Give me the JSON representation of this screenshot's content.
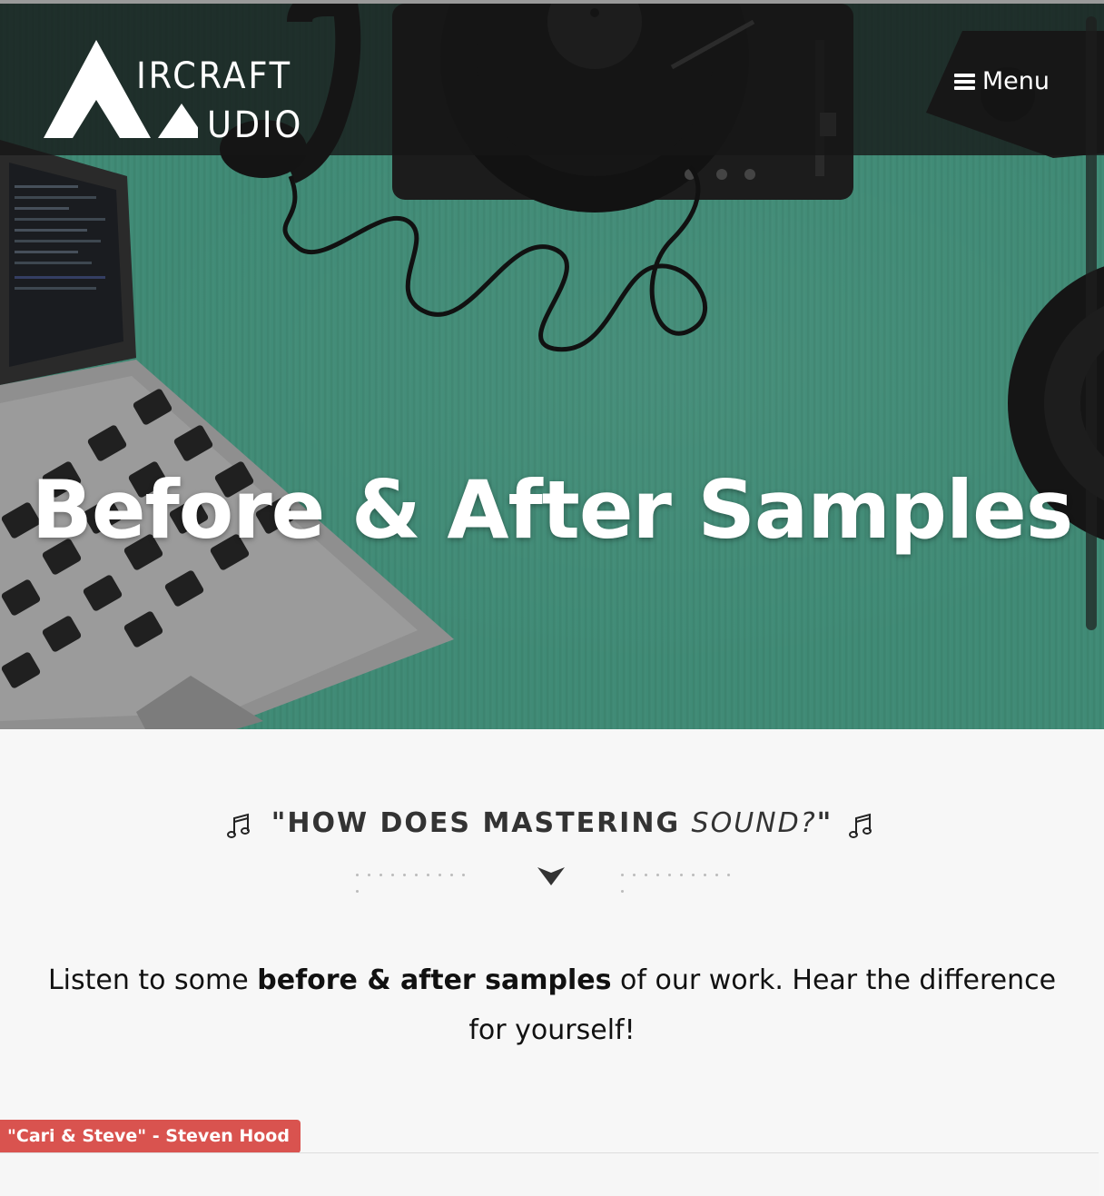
{
  "header": {
    "logo": {
      "line1": "IRCRAFT",
      "line2": "UDIO"
    },
    "menu_label": "Menu"
  },
  "hero": {
    "title": "Before & After Samples",
    "overlay_color": "#3f8a75"
  },
  "section": {
    "heading_main": "\"HOW DOES MASTERING ",
    "heading_emphasis": "SOUND?",
    "heading_end": "\"",
    "intro_lead": "Listen to some ",
    "intro_bold": "before & after samples",
    "intro_tail": " of our work. Hear the difference for yourself!"
  },
  "sample": {
    "label": "\"Cari & Steve\" - Steven Hood",
    "label_color": "#d9534f"
  },
  "icons": {
    "menu": "hamburger-icon",
    "note": "music-note-icon",
    "arrow": "chevron-down-icon"
  }
}
